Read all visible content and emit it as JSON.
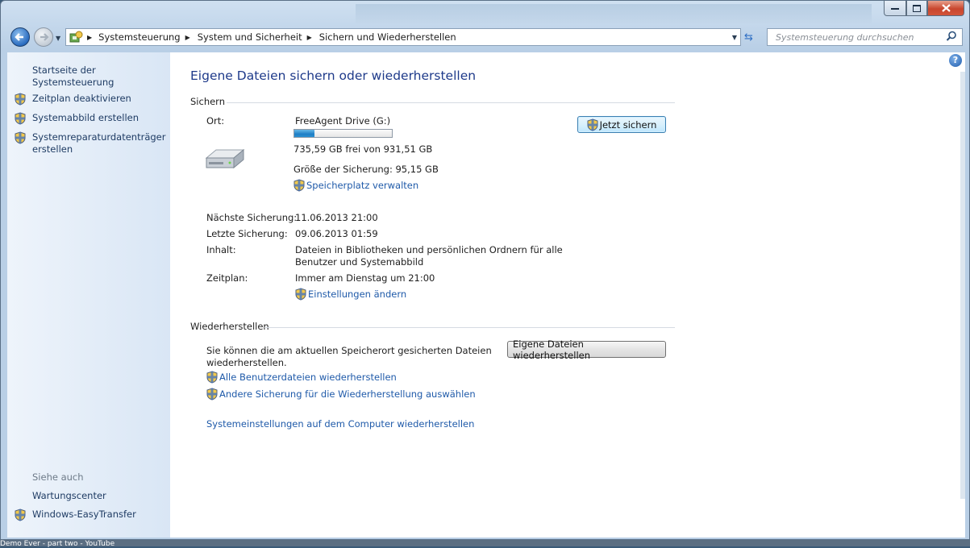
{
  "address_bar": {
    "crumbs": [
      "Systemsteuerung",
      "System und Sicherheit",
      "Sichern und Wiederherstellen"
    ]
  },
  "search": {
    "placeholder": "Systemsteuerung durchsuchen"
  },
  "sidebar": {
    "home": "Startseite der Systemsteuerung",
    "tasks": [
      "Zeitplan deaktivieren",
      "Systemabbild erstellen",
      "Systemreparaturdatenträger erstellen"
    ],
    "see_also_title": "Siehe auch",
    "see_also": [
      "Wartungscenter",
      "Windows-EasyTransfer"
    ]
  },
  "main": {
    "title": "Eigene Dateien sichern oder wiederherstellen",
    "backup": {
      "section_title": "Sichern",
      "location_label": "Ort:",
      "drive_name": "FreeAgent Drive (G:)",
      "usage_fraction": 0.21,
      "free_space": "735,59 GB frei von 931,51 GB",
      "backup_size": "Größe der Sicherung: 95,15 GB",
      "manage_space_link": "Speicherplatz verwalten",
      "backup_now_button": "Jetzt sichern",
      "next_label": "Nächste Sicherung:",
      "next_value": "11.06.2013 21:00",
      "last_label": "Letzte Sicherung:",
      "last_value": "09.06.2013 01:59",
      "content_label": "Inhalt:",
      "content_value_1": "Dateien in Bibliotheken und persönlichen Ordnern für alle",
      "content_value_2": "Benutzer und Systemabbild",
      "schedule_label": "Zeitplan:",
      "schedule_value": "Immer am Dienstag um 21:00",
      "change_settings_link": "Einstellungen ändern"
    },
    "restore": {
      "section_title": "Wiederherstellen",
      "description_1": "Sie können die am aktuellen Speicherort gesicherten Dateien",
      "description_2": "wiederherstellen.",
      "restore_button": "Eigene Dateien wiederherstellen",
      "all_users_link": "Alle Benutzerdateien wiederherstellen",
      "other_backup_link": "Andere Sicherung für die Wiederherstellung auswählen",
      "system_settings_link": "Systemeinstellungen auf dem Computer wiederherstellen"
    }
  },
  "taskbar_snippet": "Demo Ever - part two - YouTube"
}
